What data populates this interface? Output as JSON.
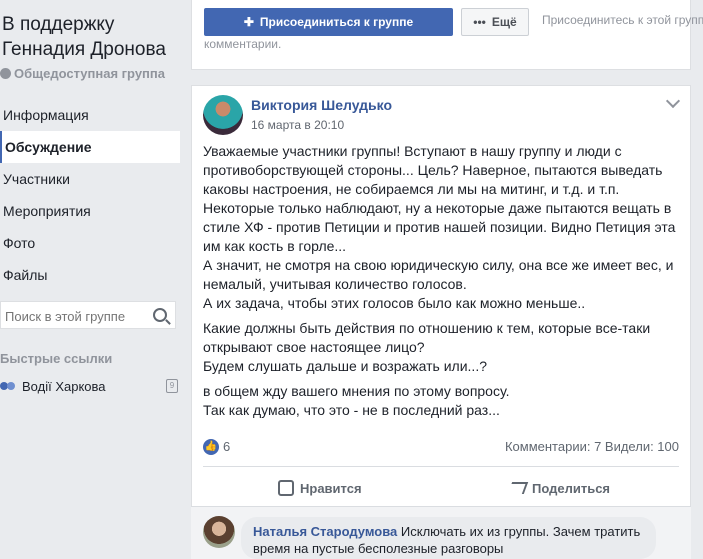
{
  "sidebar": {
    "group_title": "В поддержку Геннадия Дронова",
    "group_type": "Общедоступная группа",
    "nav": [
      "Информация",
      "Обсуждение",
      "Участники",
      "Мероприятия",
      "Фото",
      "Файлы"
    ],
    "active_nav": "Обсуждение",
    "search_placeholder": "Поиск в этой группе",
    "quick_links_title": "Быстрые ссылки",
    "quick_link": "Водії Харкова"
  },
  "topbar": {
    "join_label": "Присоединиться к группе",
    "more_label": "Ещё",
    "join_note": "Присоединитесь к этой групп",
    "comments_note": "комментарии."
  },
  "post": {
    "author": "Виктория Шелудько",
    "date": "16 марта в 20:10",
    "paragraphs": [
      "Уважаемые участники группы! Вступают в нашу группу и люди с противоборствующей стороны... Цель? Наверное, пытаются выведать каковы настроения, не собираемся ли мы на митинг, и т.д. и т.п. Некоторые только наблюдают, ну а некоторые даже пытаются вещать в стиле ХФ - против Петиции и против нашей позиции. Видно Петиция эта им как кость в горле...\nА значит, не смотря на свою юридическую силу, она все же имеет вес, и немалый, учитывая количество голосов.\nА их задача, чтобы этих голосов было как можно меньше..",
      "Какие должны быть действия по отношению к тем, которые все-таки открывают свое настоящее лицо?\nБудем слушать дальше и возражать или...?",
      "в общем жду вашего мнения по этому вопросу.\nТак как думаю, что это - не в последний раз..."
    ],
    "likes": "6",
    "stats": "Комментарии: 7  Видели: 100",
    "like_action": "Нравится",
    "share_action": "Поделиться"
  },
  "comment": {
    "author": "Наталья Стародумова",
    "text": "Исключать их из группы. Зачем тратить время на пустые бесполезные разговоры"
  }
}
